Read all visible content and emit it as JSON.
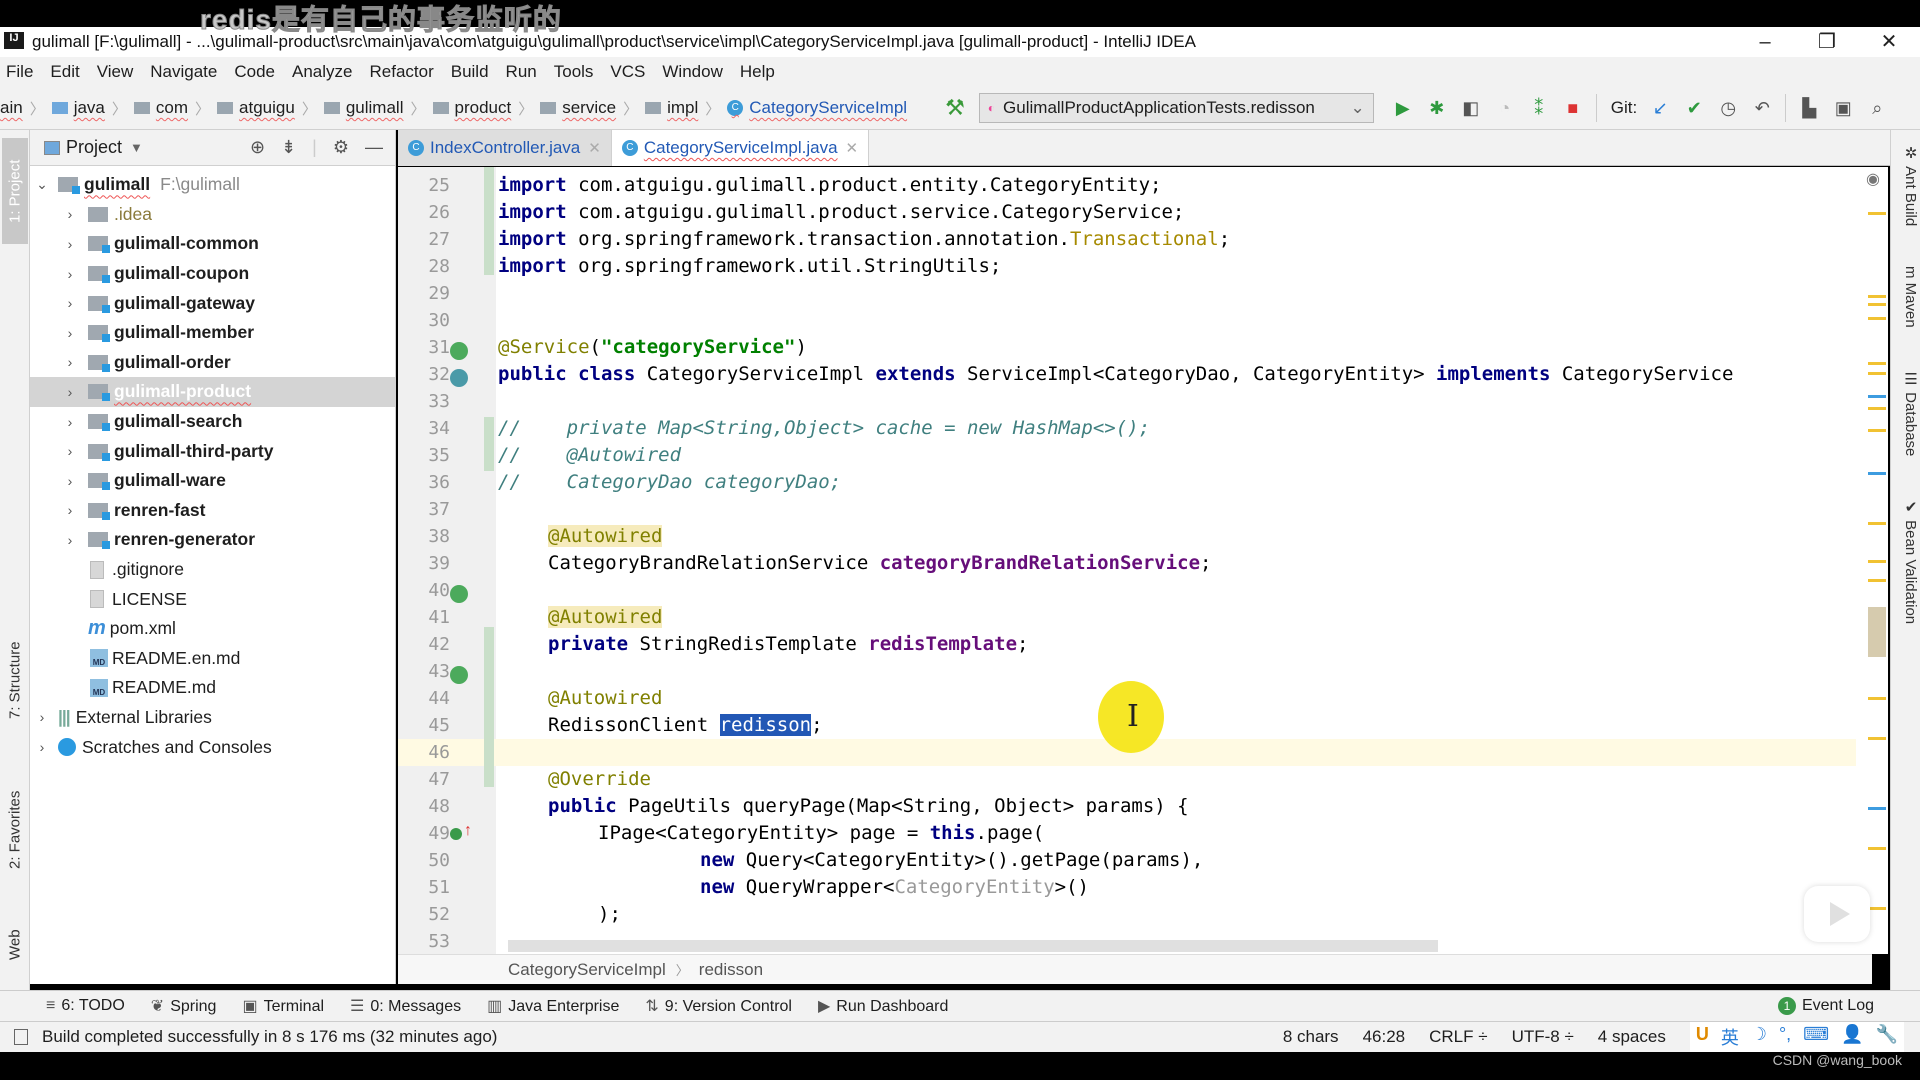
{
  "overlay": {
    "subtitle": "redis是有自己的事务监听的",
    "watermark": "CSDN @wang_book"
  },
  "window": {
    "app_icon": "IJ",
    "title": "gulimall [F:\\gulimall] - ...\\gulimall-product\\src\\main\\java\\com\\atguigu\\gulimall\\product\\service\\impl\\CategoryServiceImpl.java [gulimall-product] - IntelliJ IDEA",
    "controls": {
      "minimize": "–",
      "restore": "❐",
      "close": "✕"
    }
  },
  "menu": [
    "File",
    "Edit",
    "View",
    "Navigate",
    "Code",
    "Analyze",
    "Refactor",
    "Build",
    "Run",
    "Tools",
    "VCS",
    "Window",
    "Help"
  ],
  "navbar": {
    "breadcrumbs": [
      "ain",
      "java",
      "com",
      "atguigu",
      "gulimall",
      "product",
      "service",
      "impl",
      "CategoryServiceImpl"
    ],
    "run_config": "GulimallProductApplicationTests.redisson",
    "git_label": "Git:",
    "icons": [
      "build-hammer",
      "run",
      "debug",
      "coverage",
      "profile",
      "attach",
      "stop",
      "git-update",
      "git-commit",
      "history",
      "rollback",
      "project-structure",
      "terminal",
      "search"
    ]
  },
  "left_strip": {
    "tabs": [
      "1: Project",
      "7: Structure",
      "2: Favorites",
      "Web"
    ]
  },
  "right_strip": {
    "tabs": [
      "Ant Build",
      "Maven",
      "Database",
      "Bean Validation"
    ]
  },
  "project": {
    "title": "Project",
    "root": {
      "name": "gulimall",
      "path": "F:\\gulimall"
    },
    "items": [
      {
        "name": ".idea",
        "type": "folder"
      },
      {
        "name": "gulimall-common",
        "type": "module"
      },
      {
        "name": "gulimall-coupon",
        "type": "module"
      },
      {
        "name": "gulimall-gateway",
        "type": "module"
      },
      {
        "name": "gulimall-member",
        "type": "module"
      },
      {
        "name": "gulimall-order",
        "type": "module"
      },
      {
        "name": "gulimall-product",
        "type": "module",
        "selected": true
      },
      {
        "name": "gulimall-search",
        "type": "module"
      },
      {
        "name": "gulimall-third-party",
        "type": "module"
      },
      {
        "name": "gulimall-ware",
        "type": "module"
      },
      {
        "name": "renren-fast",
        "type": "module"
      },
      {
        "name": "renren-generator",
        "type": "module"
      },
      {
        "name": ".gitignore",
        "type": "file"
      },
      {
        "name": "LICENSE",
        "type": "file"
      },
      {
        "name": "pom.xml",
        "type": "maven"
      },
      {
        "name": "README.en.md",
        "type": "md"
      },
      {
        "name": "README.md",
        "type": "md"
      }
    ],
    "external": "External Libraries",
    "scratches": "Scratches and Consoles"
  },
  "tabs": [
    {
      "label": "IndexController.java",
      "active": false
    },
    {
      "label": "CategoryServiceImpl.java",
      "active": true
    }
  ],
  "editor": {
    "line_numbers": [
      "25",
      "26",
      "27",
      "28",
      "29",
      "30",
      "31",
      "32",
      "33",
      "34",
      "35",
      "36",
      "37",
      "38",
      "39",
      "40",
      "41",
      "42",
      "43",
      "44",
      "45",
      "46",
      "47",
      "48",
      "49",
      "50",
      "51",
      "52",
      "53"
    ],
    "current_line": "46",
    "lines": {
      "l25a": "import",
      "l25b": " com.atguigu.gulimall.product.entity.CategoryEntity;",
      "l26a": "import",
      "l26b": " com.atguigu.gulimall.product.service.CategoryService;",
      "l27a": "import",
      "l27b": " org.springframework.transaction.annotation.",
      "l27c": "Transactional",
      "l27d": ";",
      "l28a": "import",
      "l28b": " org.springframework.util.StringUtils;",
      "l31a": "@Service",
      "l31b": "(",
      "l31c": "\"categoryService\"",
      "l31d": ")",
      "l32a": "public class",
      "l32b": " CategoryServiceImpl ",
      "l32c": "extends",
      "l32d": " ServiceImpl<CategoryDao, CategoryEntity> ",
      "l32e": "implements",
      "l32f": " CategoryService",
      "l35": "//    private Map<String,Object> cache = new HashMap<>();",
      "l36": "//    @Autowired",
      "l37": "//    CategoryDao categoryDao;",
      "l39": "@Autowired",
      "l40a": "CategoryBrandRelationService ",
      "l40b": "categoryBrandRelationService",
      "l40c": ";",
      "l42": "@Autowired",
      "l43a": "private",
      "l43b": " StringRedisTemplate ",
      "l43c": "redisTemplate",
      "l43d": ";",
      "l45": "@Autowired",
      "l46a": "RedissonClient ",
      "l46b": "redisson",
      "l46c": ";",
      "l48": "@Override",
      "l49a": "public",
      "l49b": " PageUtils queryPage(Map<String, Object> params) {",
      "l50a": "IPage<CategoryEntity> page = ",
      "l50b": "this",
      "l50c": ".page(",
      "l51a": "new",
      "l51b": " Query<CategoryEntity>().getPage(params),",
      "l52a": "new",
      "l52b": " QueryWrapper<",
      "l52c": "CategoryEntity",
      "l52d": ">()",
      "l53": ");"
    },
    "breadcrumb": [
      "CategoryServiceImpl",
      "redisson"
    ]
  },
  "tool_windows": [
    {
      "label": "6: TODO",
      "icon": "≡"
    },
    {
      "label": "Spring",
      "icon": "❦"
    },
    {
      "label": "Terminal",
      "icon": "▣"
    },
    {
      "label": "0: Messages",
      "icon": "☰"
    },
    {
      "label": "Java Enterprise",
      "icon": "▥"
    },
    {
      "label": "9: Version Control",
      "icon": "⇅"
    },
    {
      "label": "Run Dashboard",
      "icon": "▶"
    }
  ],
  "event_log": {
    "label": "Event Log",
    "count": "1"
  },
  "status": {
    "message": "Build completed successfully in 8 s 176 ms (32 minutes ago)",
    "selection": "8 chars",
    "position": "46:28",
    "line_sep": "CRLF ÷",
    "encoding": "UTF-8 ÷",
    "indent": "4 spaces",
    "ime": [
      "U",
      "英",
      "☽",
      "°,",
      "⌨",
      "👤",
      "🔧"
    ]
  }
}
